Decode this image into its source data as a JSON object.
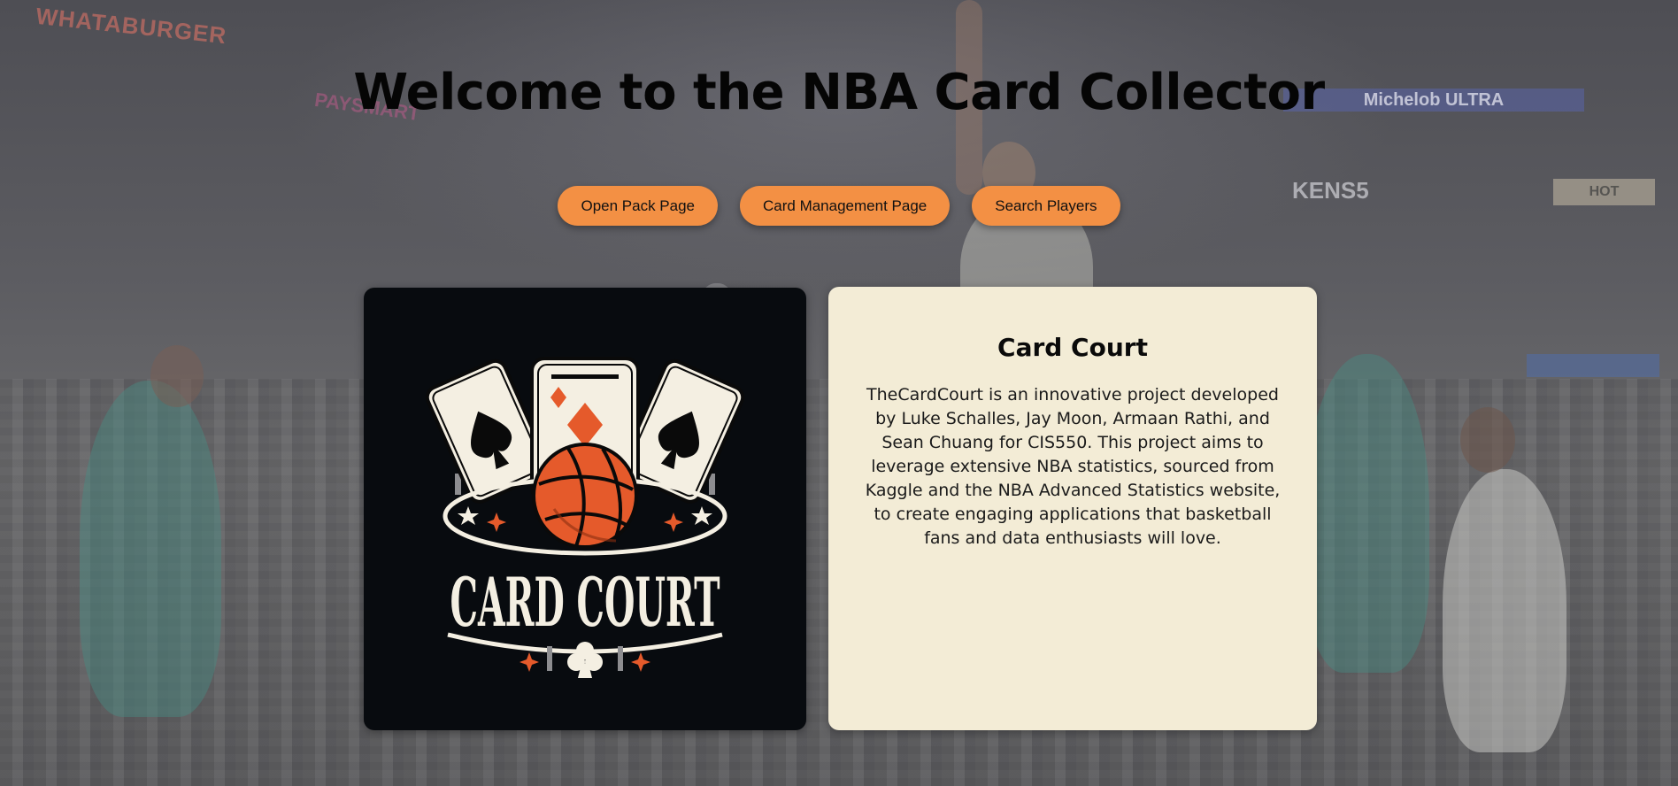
{
  "page": {
    "title": "Welcome to the NBA Card Collector"
  },
  "nav": {
    "buttons": [
      {
        "label": "Open Pack Page"
      },
      {
        "label": "Card Management Page"
      },
      {
        "label": "Search Players"
      }
    ]
  },
  "background": {
    "signs": [
      "WHATABURGER",
      "PAYSMART",
      "Michelob ULTRA",
      "KENS5",
      "HOT"
    ]
  },
  "logo": {
    "text": "CARD COURT"
  },
  "info": {
    "title": "Card Court",
    "description": "TheCardCourt is an innovative project developed by Luke Schalles, Jay Moon, Armaan Rathi, and Sean Chuang for CIS550. This project aims to leverage extensive NBA statistics, sourced from Kaggle and the NBA Advanced Statistics website, to create engaging applications that basketball fans and data enthusiasts will love."
  },
  "colors": {
    "button": "#f39044",
    "info_card": "#f3ecd6",
    "logo_card": "#080b0f",
    "logo_orange": "#e55a2b",
    "logo_cream": "#f4efe2"
  }
}
